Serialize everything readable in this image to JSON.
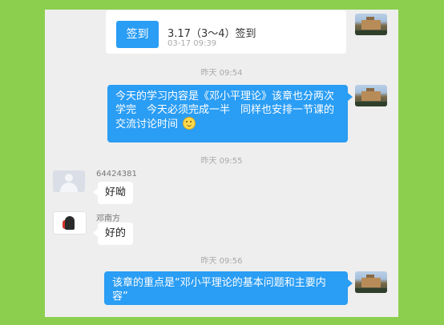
{
  "checkin": {
    "button_label": "签到",
    "title": "3.17（3～4）签到",
    "time": "03-17 09:39"
  },
  "timestamps": {
    "t1": "昨天 09:54",
    "t2": "昨天 09:55",
    "t3": "昨天 09:56"
  },
  "messages": {
    "m1": {
      "text": "今天的学习内容是《邓小平理论》该章也分两次学完　今天必须完成一半　同样也安排一节课的交流讨论时间",
      "emoji": "smile-emoji"
    },
    "m2": {
      "sender": "64424381",
      "text": "好呦"
    },
    "m3": {
      "sender": "邓南方",
      "text": "好的"
    },
    "m4": {
      "text": "该章的重点是“邓小平理论的基本问题和主要内容”"
    }
  },
  "colors": {
    "background": "#8ccf4f",
    "chat_bg": "#eeeeee",
    "accent_blue": "#2a9df4",
    "timestamp_gray": "#a9a9a9"
  }
}
